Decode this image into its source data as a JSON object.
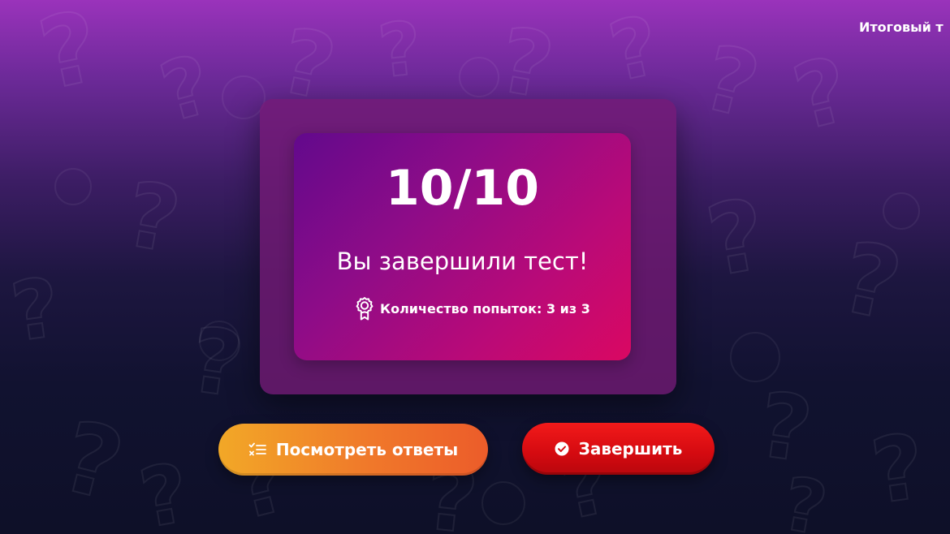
{
  "header": {
    "title": "Итоговый т"
  },
  "result": {
    "score": "10/10",
    "message": "Вы завершили тест!",
    "attempts_text": "Количество попыток: 3 из 3",
    "attempts_icon": "award-icon"
  },
  "actions": {
    "view_answers": {
      "label": "Посмотреть ответы",
      "icon": "checklist-icon"
    },
    "finish": {
      "label": "Завершить",
      "icon": "check-circle-icon"
    }
  },
  "colors": {
    "bg_top": "#9a33bb",
    "bg_bottom": "#0e1028",
    "card_outer": "#751a76",
    "card_inner_start": "#62098c",
    "card_inner_end": "#da0862",
    "answers_button_start": "#f2a827",
    "answers_button_end": "#ec5c2a",
    "finish_button": "#d40a10"
  }
}
